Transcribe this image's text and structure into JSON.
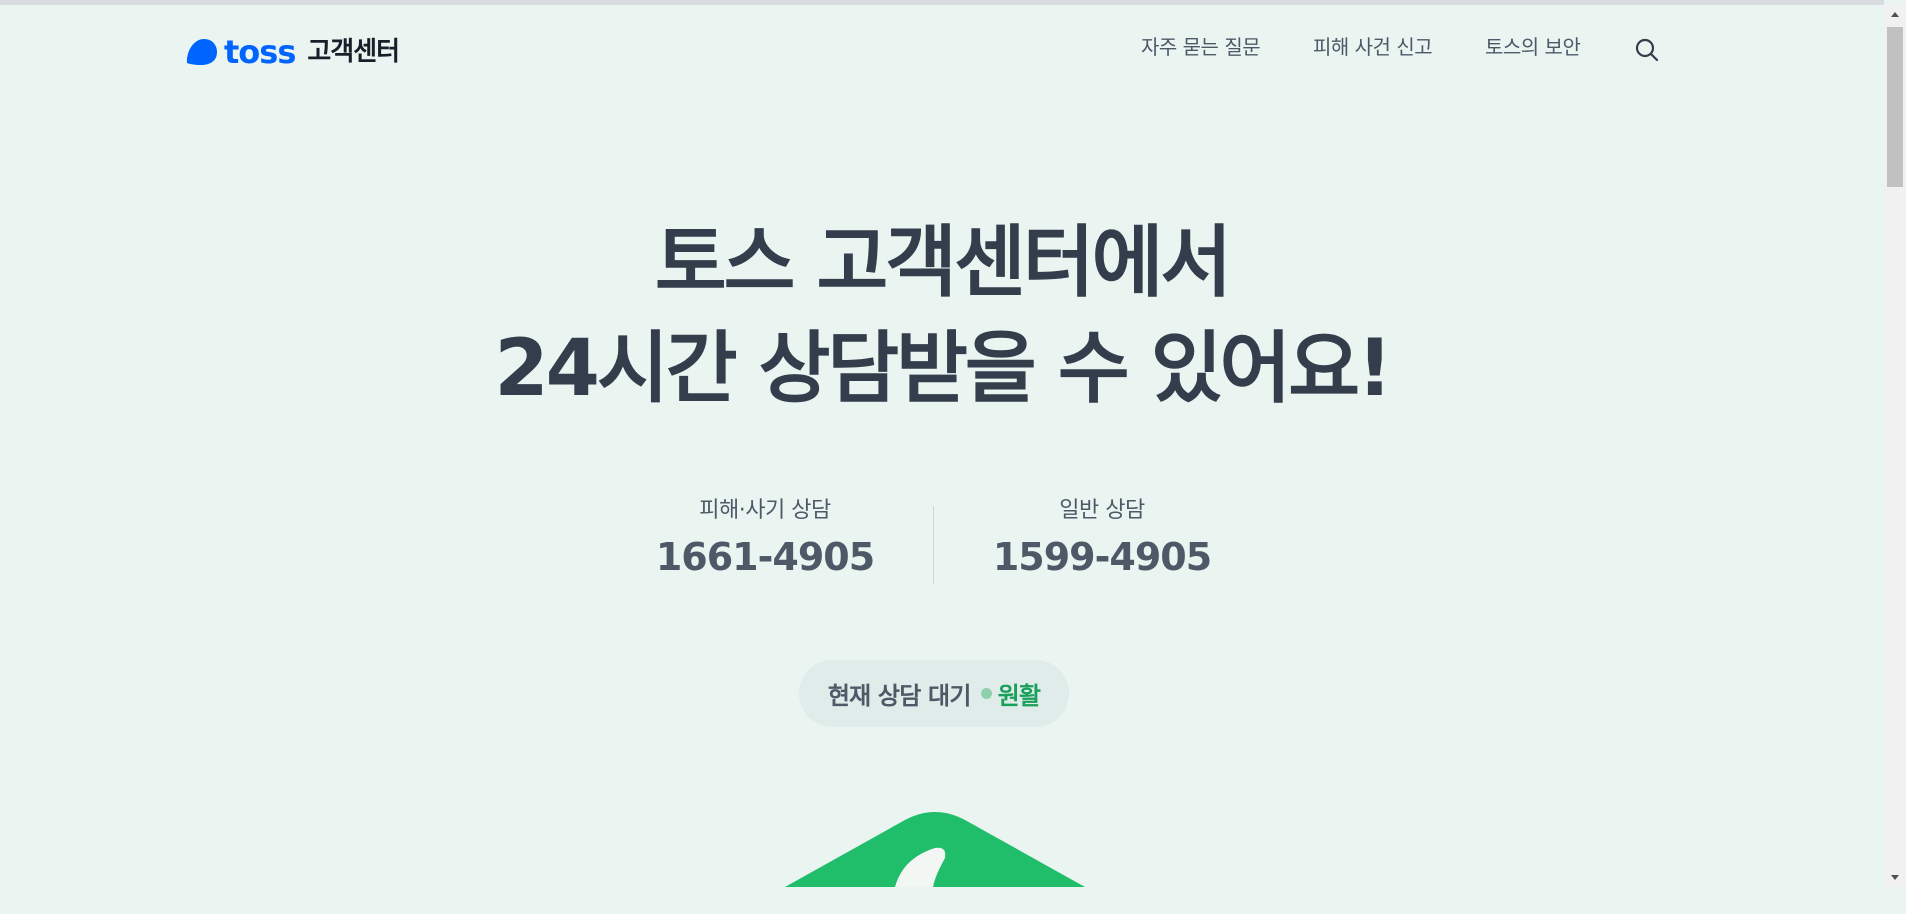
{
  "header": {
    "logo_word": "toss",
    "logo_sub": "고객센터",
    "nav": [
      {
        "label": "자주 묻는 질문"
      },
      {
        "label": "피해 사건 신고"
      },
      {
        "label": "토스의 보안"
      }
    ],
    "search_icon": "search-icon"
  },
  "hero": {
    "line1": "토스 고객센터에서",
    "line2": "24시간 상담받을 수 있어요!"
  },
  "contacts": [
    {
      "label": "피해·사기 상담",
      "number": "1661-4905"
    },
    {
      "label": "일반 상담",
      "number": "1599-4905"
    }
  ],
  "status": {
    "label": "현재 상담 대기",
    "value": "원활",
    "value_color": "#1aa05a"
  },
  "colors": {
    "background": "#eaf4f1",
    "brand_blue": "#0064ff",
    "brand_green": "#20bd6a",
    "text_main": "#333d4b",
    "text_sub": "#4e5968"
  }
}
